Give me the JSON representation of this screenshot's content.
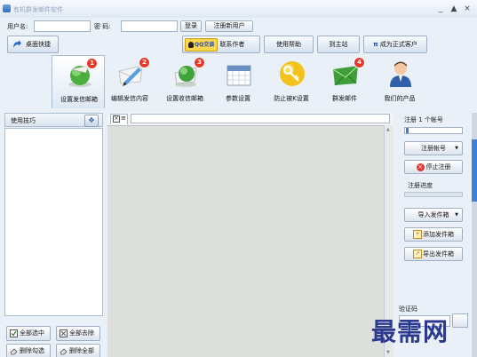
{
  "window": {
    "title": "有机群发邮件软件",
    "controls": {
      "minimize": "_",
      "maximize": "▲",
      "close": "×"
    }
  },
  "login": {
    "username_label": "用户名:",
    "username_value": "",
    "password_label": "密  码:",
    "password_value": "",
    "login_button": "登录",
    "register_button": "注册新用户"
  },
  "toolbar": {
    "shortcut_button": "桌面快捷",
    "qq_button": "QQ交谈",
    "contact_author": "联系作者",
    "help_button": "使用帮助",
    "home_button": "到主站",
    "upgrade_button": "成为正式客户"
  },
  "ribbon": [
    {
      "label": "设置发信邮箱",
      "badge": "1",
      "icon": "email-globe-icon"
    },
    {
      "label": "编辑发信内容",
      "badge": "2",
      "icon": "edit-letter-icon"
    },
    {
      "label": "设置收信邮箱",
      "badge": "3",
      "icon": "receive-mail-icon"
    },
    {
      "label": "参数设置",
      "badge": "",
      "icon": "calendar-icon"
    },
    {
      "label": "防止被K设置",
      "badge": "",
      "icon": "key-icon"
    },
    {
      "label": "群发邮件",
      "badge": "4",
      "icon": "mail-envelope-icon"
    },
    {
      "label": "我们的产品",
      "badge": "",
      "icon": "person-icon"
    }
  ],
  "left_panel": {
    "title": "使用技巧",
    "select_all": "全部选中",
    "deselect_all": "全部去除",
    "delete_checked": "删除勾选",
    "delete_all": "删除全部"
  },
  "right_panel": {
    "register_count": "注册 1 个帐号",
    "register_account": "注册帐号",
    "stop_register": "停止注册",
    "register_progress": "注册进度",
    "import_sender": "导入发件箱",
    "add_sender": "添加发件箱",
    "export_sender": "导出发件箱",
    "captcha_label": "验证码"
  },
  "watermark": "最需网",
  "colors": {
    "window_bg": "#e9f0f8",
    "accent_blue": "#3e7ed6",
    "badge_red": "#e53a2b"
  }
}
